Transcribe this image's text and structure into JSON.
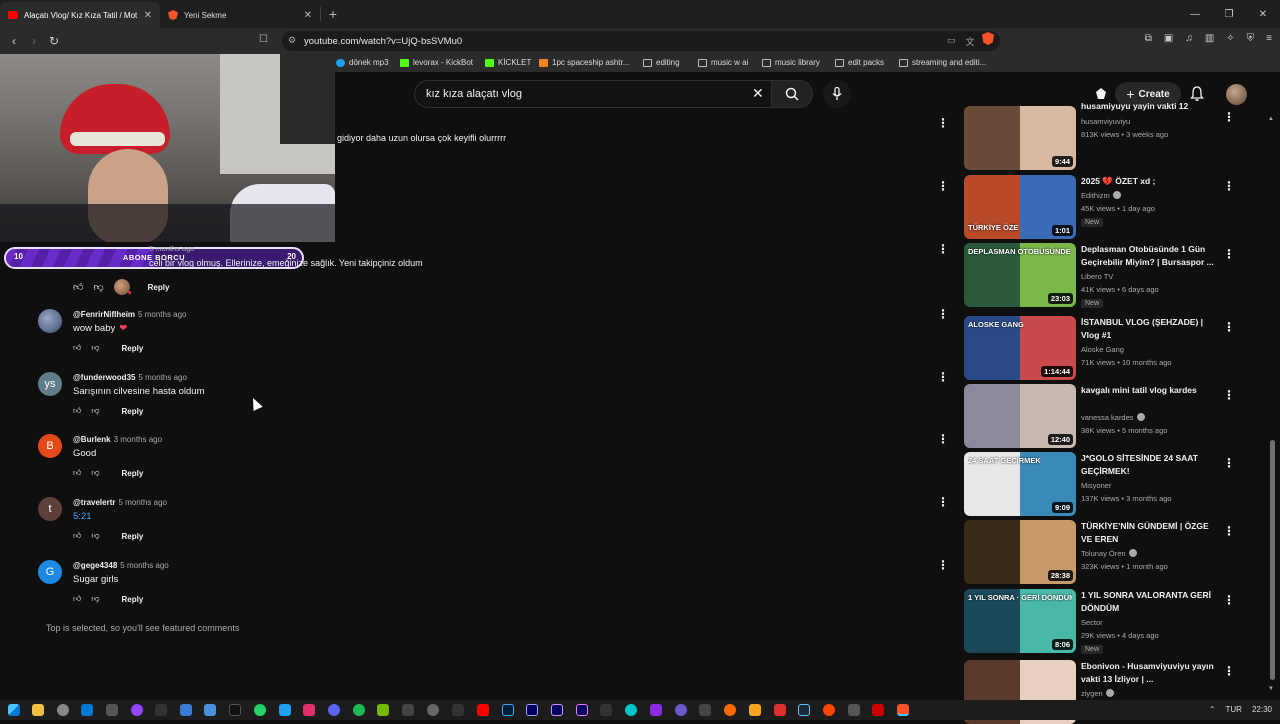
{
  "browser": {
    "tabs": [
      {
        "title": "Alaçatı Vlog/ Kız Kıza Tatil / Mot",
        "close": "✕"
      },
      {
        "title": "Yeni Sekme",
        "close": "✕"
      }
    ],
    "new_tab": "+",
    "url": "youtube.com/watch?v=UjQ-bsSVMu0",
    "bookmarks": [
      {
        "label": "dönek mp3"
      },
      {
        "label": "levorax - KickBot"
      },
      {
        "label": "KİCKLET"
      },
      {
        "label": "1pc spaceship ashtr..."
      },
      {
        "label": "editing"
      },
      {
        "label": "music w ai"
      },
      {
        "label": "music library"
      },
      {
        "label": "edit packs"
      },
      {
        "label": "streaming and editi..."
      }
    ]
  },
  "youtube": {
    "search_query": "kız kıza alaçatı vlog",
    "create_label": "Create"
  },
  "stream_overlay": {
    "sub_goal_label": "ABONE BORCU",
    "current": "10",
    "target": "20",
    "progress_fraction": 0.5
  },
  "comments": {
    "partial_top": {
      "text": "gidiyor daha uzun olursa çok keyifli olurrrrr"
    },
    "partial_second": {
      "time": "5 months ago",
      "text": "celi bir vlog olmuş. Ellerinize, emeğinize sağlık. Yeni takipçiniz oldum",
      "reply": "Reply"
    },
    "items": [
      {
        "author": "@FenrirNiflheim",
        "time": "5 months ago",
        "text": "wow baby",
        "heart": "❤",
        "avatar_letter": "",
        "avatar_color": "#5a6a8a",
        "reply": "Reply"
      },
      {
        "author": "@funderwood35",
        "time": "5 months ago",
        "text": "Sarışının cilvesine hasta oldum",
        "avatar_letter": "ys",
        "avatar_color": "#607d8b",
        "reply": "Reply"
      },
      {
        "author": "@Burlenk",
        "time": "3 months ago",
        "text": "Good",
        "avatar_letter": "B",
        "avatar_color": "#e64a19",
        "reply": "Reply"
      },
      {
        "author": "@travelertr",
        "time": "5 months ago",
        "text": "5:21",
        "avatar_letter": "t",
        "avatar_color": "#5d4037",
        "reply": "Reply"
      },
      {
        "author": "@gege4348",
        "time": "5 months ago",
        "text": "Sugar girls",
        "avatar_letter": "G",
        "avatar_color": "#1e88e5",
        "reply": "Reply"
      }
    ],
    "featured_note": "Top is selected, so you'll see featured comments"
  },
  "recommendations": [
    {
      "title": "husamiyuyu yayin vakti 12",
      "channel": "husamviyuviyu",
      "verified": false,
      "stats": "813K views • 3 weeks ago",
      "duration": "9:44",
      "badge": "",
      "thumb_colors": [
        "#6b4a3a",
        "#d8b8a0"
      ]
    },
    {
      "title": "2025 💔 ÖZET xd ;",
      "channel": "Edithizm",
      "verified": true,
      "stats": "45K views • 1 day ago",
      "duration": "1:01",
      "badge": "New",
      "thumb_colors": [
        "#b84a2a",
        "#3a6ab8"
      ],
      "thumb_text": "TÜRKİYE ÖZE"
    },
    {
      "title": "Deplasman Otobüsünde 1 Gün Geçirebilir Miyim? | Bursaspor ...",
      "channel": "Libero TV",
      "verified": false,
      "stats": "41K views • 6 days ago",
      "duration": "23:03",
      "badge": "New",
      "thumb_colors": [
        "#2a5a3a",
        "#7ab84a"
      ],
      "thumb_text": "DEPLASMAN OTOBÜSÜNDE"
    },
    {
      "title": "İSTANBUL VLOG (ŞEHZADE) | Vlog #1",
      "channel": "Aloske Gang",
      "verified": false,
      "stats": "71K views • 10 months ago",
      "duration": "1:14:44",
      "badge": "",
      "thumb_colors": [
        "#2a4a8a",
        "#c84a4a"
      ],
      "thumb_text": "ALOSKE GANG"
    },
    {
      "title": "kavgalı mini tatil vlog kardes",
      "channel": "vanessa kardes",
      "verified": true,
      "stats": "38K views • 5 months ago",
      "duration": "12:40",
      "badge": "",
      "thumb_colors": [
        "#8a8a9a",
        "#c8b8b0"
      ]
    },
    {
      "title": "J*GOLO SİTESİNDE 24 SAAT GEÇİRMEK!",
      "channel": "Misyoner",
      "verified": false,
      "stats": "137K views • 3 months ago",
      "duration": "9:09",
      "badge": "",
      "thumb_colors": [
        "#e8e8e8",
        "#3a8ab8"
      ],
      "thumb_text": "24 SAAT GEÇİRMEK"
    },
    {
      "title": "TÜRKİYE'NİN GÜNDEMİ | ÖZGE VE EREN",
      "channel": "Tolunay Ören",
      "verified": true,
      "stats": "323K views • 1 month ago",
      "duration": "28:38",
      "badge": "",
      "thumb_colors": [
        "#3a2a1a",
        "#c89a6a"
      ]
    },
    {
      "title": "1 YIL SONRA VALORANTA GERİ DÖNDÜM",
      "channel": "Sector",
      "verified": false,
      "stats": "29K views • 4 days ago",
      "duration": "8:06",
      "badge": "New",
      "thumb_colors": [
        "#1a4a5a",
        "#4ab8a8"
      ],
      "thumb_text": "1 YIL SONRA · GERİ DÖNDÜM"
    },
    {
      "title": "Ebonivon - Husamviyuviyu yayın vakti 13 İzliyor | ...",
      "channel": "ziygen",
      "verified": true,
      "stats": "",
      "duration": "",
      "badge": "",
      "thumb_colors": [
        "#5a3a2a",
        "#e8d0c0"
      ]
    }
  ],
  "taskbar": {
    "lang": "TUR",
    "time": "22:30"
  }
}
